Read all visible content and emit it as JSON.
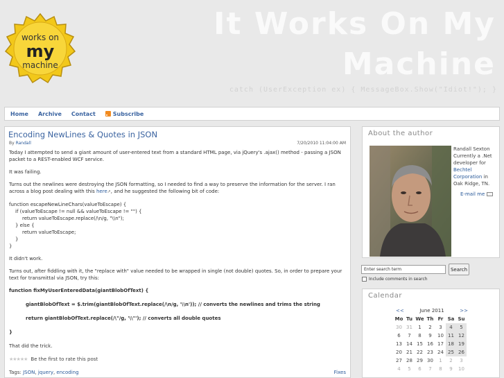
{
  "header": {
    "logo_top": "works on",
    "logo_mid": "my",
    "logo_bottom": "machine",
    "title_line1": "It Works On My",
    "title_line2": "Machine",
    "tagline": "catch (UserException ex) { MessageBox.Show(\"Idiot!\"); }"
  },
  "nav": {
    "items": [
      "Home",
      "Archive",
      "Contact",
      "Subscribe"
    ]
  },
  "post": {
    "title": "Encoding NewLines & Quotes in JSON",
    "by": "By",
    "author": "Randall",
    "date": "7/20/2010 11:04:00 AM",
    "p1": "Today I attempted to send a giant amount of user-entered text from a standard HTML page, via jQuery's .ajax() method - passing a JSON packet to a REST-enabled WCF service.",
    "p2": "It was failing.",
    "p3a": "Turns out the newlines were destroying the JSON formatting, so I needed to find a way to preserve the information for the server.  I ran across a blog post dealing with this",
    "p3_link": "here",
    "p3b": ", and he suggested the following bit of code:",
    "code": [
      "function escapeNewLineChars(valueToEscape) {",
      "if (valueToEscape != null && valueToEscape != \"\") {",
      "return valueToEscape.replace(/\\n/g, \"\\\\n\");",
      "} else {",
      "return valueToEscape;",
      "}",
      "}"
    ],
    "p4": "It didn't work.",
    "p5": "Turns out, after fiddling with it, the \"replace with\" value needed to be wrapped in single (not double) quotes. So, in order to prepare your text for transmittal via JSON, try this:",
    "code2": [
      "function fixMyUserEnteredData(giantBlobOfText) {",
      "giantBlobOfText = $.trim(giantBlobOfText.replace(/\\n/g, '\\\\n')); // converts the newlines and trims the string",
      "return giantBlobOfText.replace(/\\\"/g, '\\\\\"'); // converts all double quotes",
      "}"
    ],
    "p6": "That did the trick.",
    "rating_text": "Be the first to rate this post",
    "tags_label": "Tags:",
    "tags": [
      "JSON",
      "jquery",
      "encoding"
    ],
    "category": "Fixes"
  },
  "about": {
    "title": "About the author",
    "text1": "Randall Sexton Currently a .Net developer for",
    "company": "Bechtel Corporation",
    "text2": "in Oak Ridge, TN.",
    "email": "E-mail me"
  },
  "search": {
    "placeholder": "Enter search term",
    "button": "Search",
    "checkbox_label": "Include comments in search"
  },
  "calendar": {
    "title": "Calendar",
    "prev": "<<",
    "month": "June 2011",
    "next": ">>",
    "days": [
      "Mo",
      "Tu",
      "We",
      "Th",
      "Fr",
      "Sa",
      "Su"
    ],
    "weeks": [
      [
        "30",
        "31",
        "1",
        "2",
        "3",
        "4",
        "5"
      ],
      [
        "6",
        "7",
        "8",
        "9",
        "10",
        "11",
        "12"
      ],
      [
        "13",
        "14",
        "15",
        "16",
        "17",
        "18",
        "19"
      ],
      [
        "20",
        "21",
        "22",
        "23",
        "24",
        "25",
        "26"
      ],
      [
        "27",
        "28",
        "29",
        "30",
        "1",
        "2",
        "3"
      ],
      [
        "4",
        "5",
        "6",
        "7",
        "8",
        "9",
        "10"
      ]
    ]
  }
}
